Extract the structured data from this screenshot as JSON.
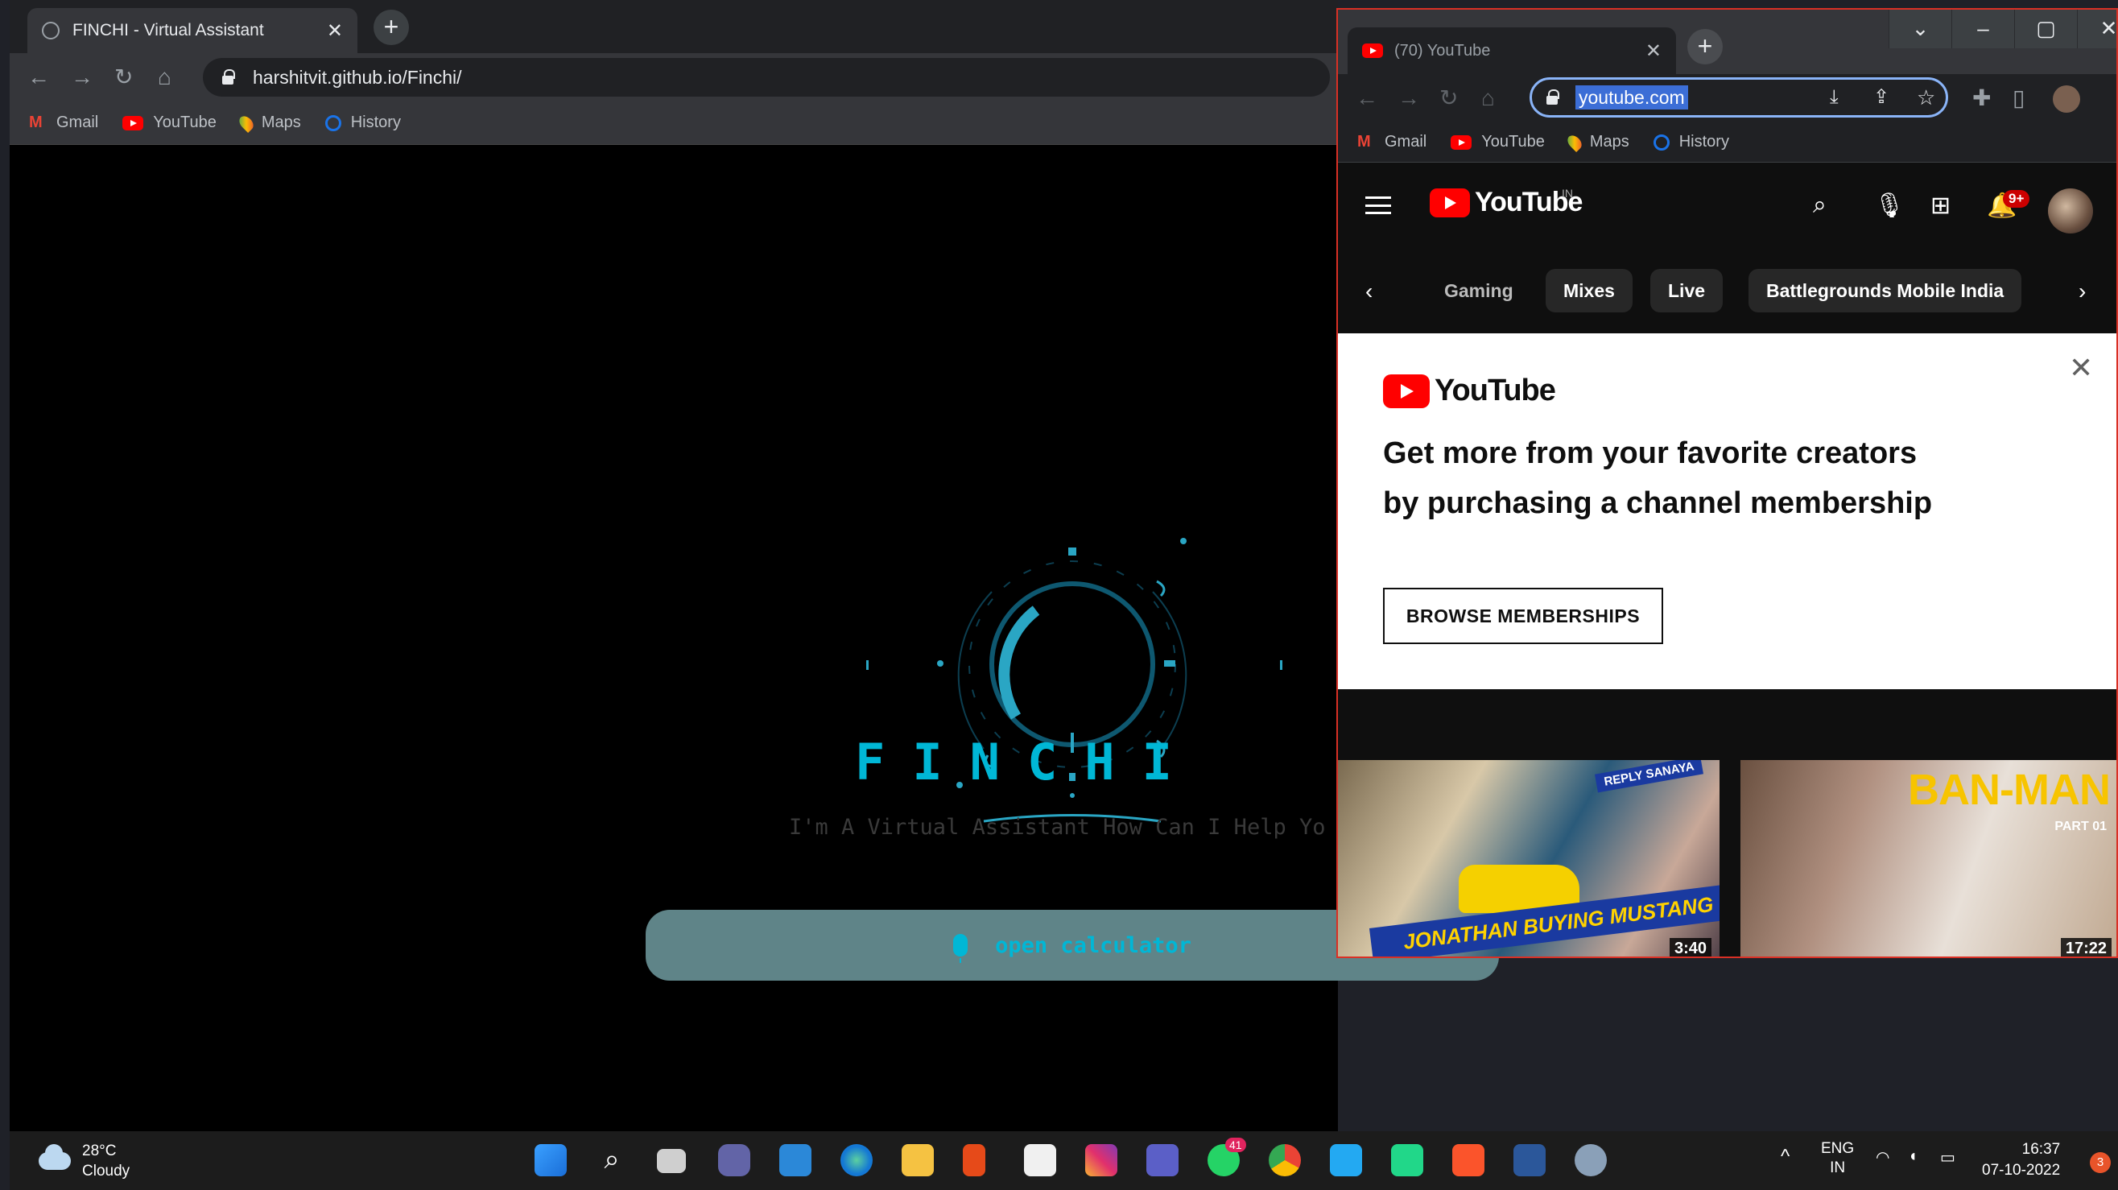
{
  "left_window": {
    "tab_title": "FINCHI - Virtual Assistant",
    "url": "harshitvit.github.io/Finchi/",
    "bookmarks": [
      "Gmail",
      "YouTube",
      "Maps",
      "History"
    ],
    "app_title": "FINCHI",
    "subtitle": "I'm A Virtual Assistant How Can I Help Yo",
    "command_text": "open calculator",
    "accent_color": "#00b7d6"
  },
  "right_window": {
    "tab_title": "(70) YouTube",
    "url": "youtube.com",
    "bookmarks": [
      "Gmail",
      "YouTube",
      "Maps",
      "History"
    ],
    "logo_text": "YouTube",
    "region": "IN",
    "notifications_badge": "9+",
    "chips": [
      "Gaming",
      "Mixes",
      "Live",
      "Battlegrounds Mobile India"
    ],
    "promo": {
      "logo_text": "YouTube",
      "headline_line1": "Get more from your favorite creators",
      "headline_line2": "by purchasing a channel membership",
      "button": "BROWSE MEMBERSHIPS"
    },
    "videos": [
      {
        "banner": "JONATHAN BUYING MUSTANG - REVEALED",
        "tag": "REPLY SANAYA",
        "duration": "3:40"
      },
      {
        "title": "BAN-MAN",
        "subtitle": "PART 01",
        "duration": "17:22"
      }
    ]
  },
  "taskbar": {
    "temperature": "28°C",
    "weather": "Cloudy",
    "whatsapp_badge": "41",
    "language": "ENG",
    "region": "IN",
    "time": "16:37",
    "date": "07-10-2022",
    "notification_count": "3"
  }
}
